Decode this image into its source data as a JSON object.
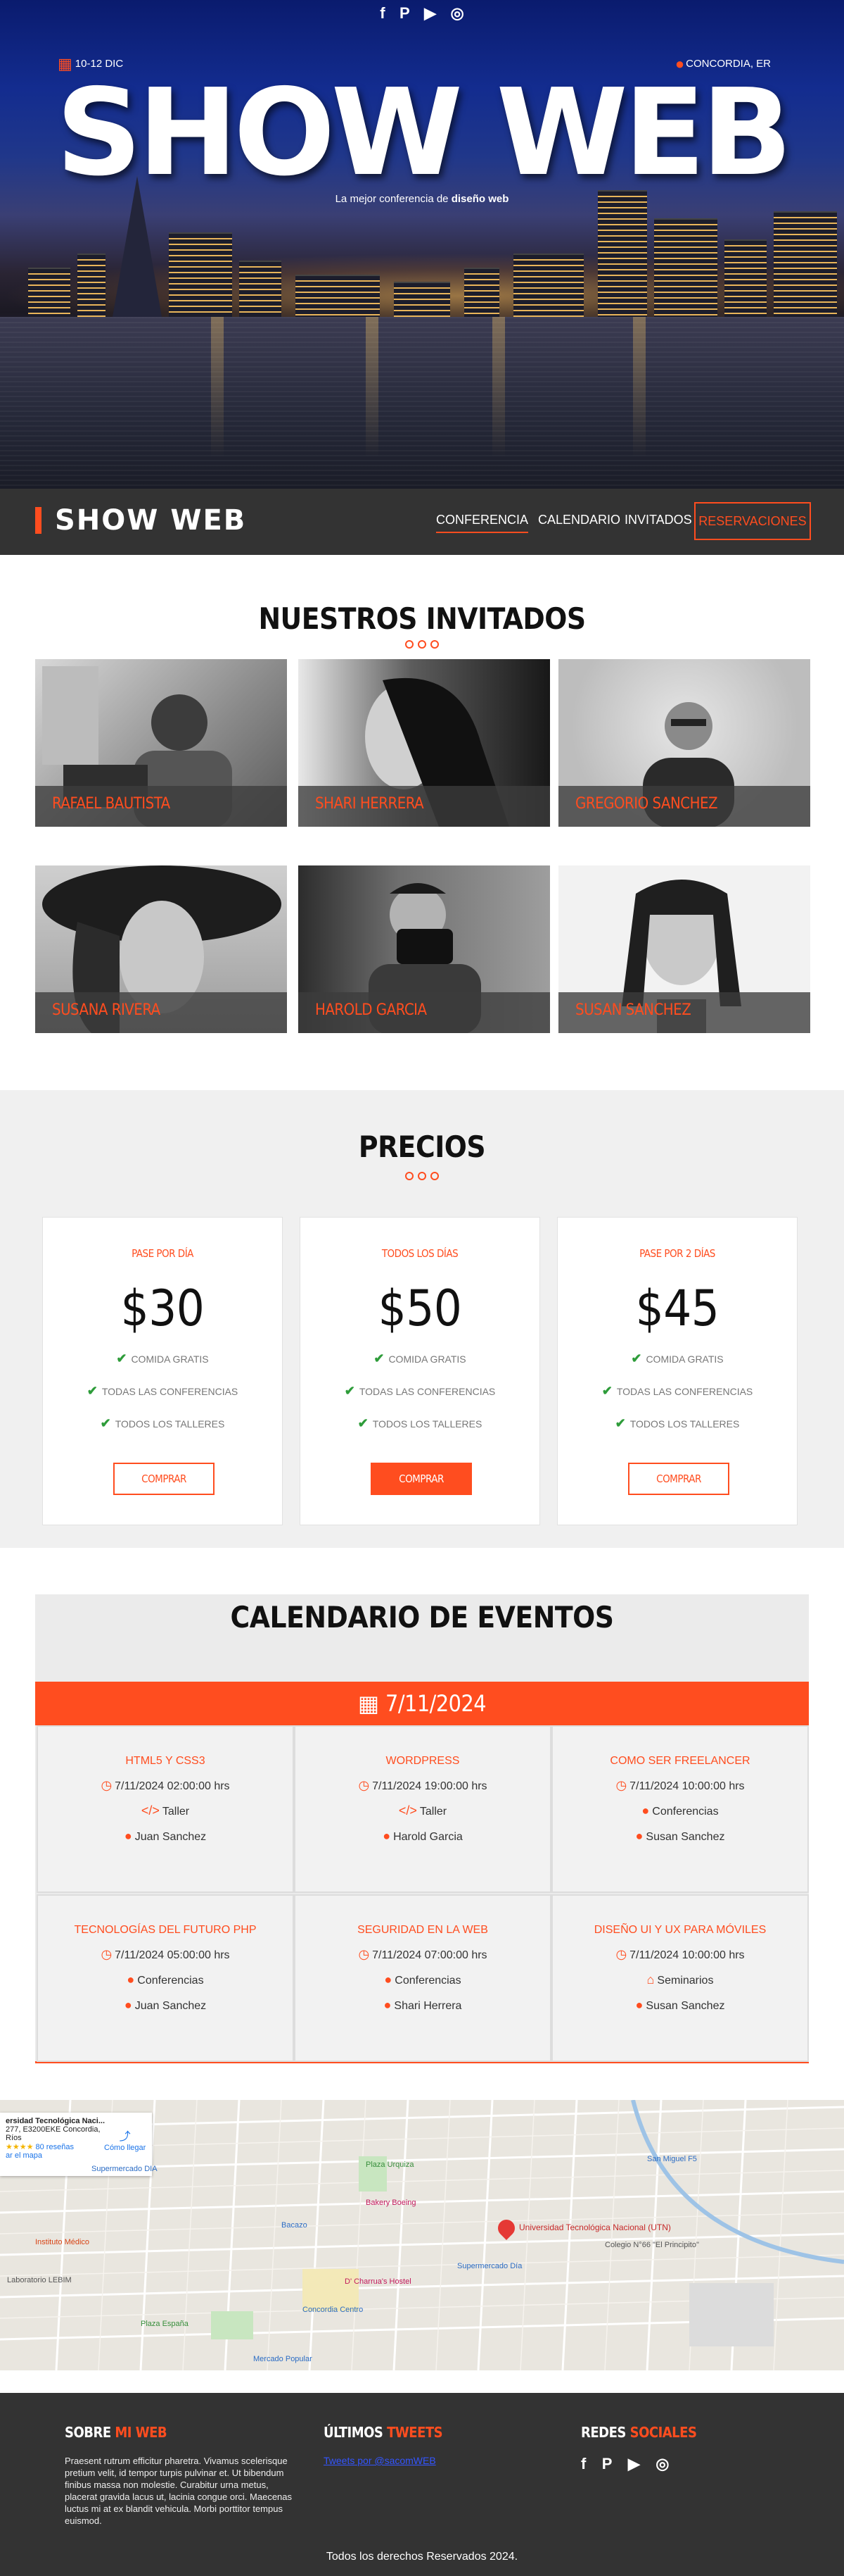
{
  "hero": {
    "social_icons": [
      "facebook-icon",
      "pinterest-icon",
      "youtube-icon",
      "instagram-icon"
    ],
    "social_glyphs": [
      "f",
      "P",
      "▶",
      "◎"
    ],
    "date": "10-12 DIC",
    "location": "CONCORDIA, ER",
    "title": "SHOW WEB",
    "subtitle_prefix": "La mejor conferencia de ",
    "subtitle_bold": "diseño web"
  },
  "nav": {
    "logo": "SHOW WEB",
    "items": [
      "CONFERENCIA",
      "CALENDARIO",
      "INVITADOS"
    ],
    "reserve": "RESERVACIONES"
  },
  "guests": {
    "title": "NUESTROS INVITADOS",
    "items": [
      "RAFAEL BAUTISTA",
      "SHARI HERRERA",
      "GREGORIO SANCHEZ",
      "SUSANA RIVERA",
      "HAROLD GARCIA",
      "SUSAN  SANCHEZ"
    ]
  },
  "prices": {
    "title": "PRECIOS",
    "plans": [
      {
        "label": "PASE POR DÍA",
        "price": "$30",
        "features": [
          "COMIDA GRATIS",
          "TODAS LAS CONFERENCIAS",
          "TODOS LOS TALLERES"
        ],
        "button": "COMPRAR"
      },
      {
        "label": "TODOS LOS DÍAS",
        "price": "$50",
        "features": [
          "COMIDA GRATIS",
          "TODAS LAS CONFERENCIAS",
          "TODOS LOS TALLERES"
        ],
        "button": "COMPRAR"
      },
      {
        "label": "PASE POR 2 DÍAS",
        "price": "$45",
        "features": [
          "COMIDA GRATIS",
          "TODAS LAS CONFERENCIAS",
          "TODOS LOS TALLERES"
        ],
        "button": "COMPRAR"
      }
    ]
  },
  "calendar": {
    "title": "CALENDARIO DE EVENTOS",
    "date": "7/11/2024",
    "events": [
      {
        "title": "HTML5 Y CSS3",
        "time": "7/11/2024 02:00:00 hrs",
        "category": "Taller",
        "cat_icon": "code-icon",
        "speaker": "Juan Sanchez"
      },
      {
        "title": "WORDPRESS",
        "time": "7/11/2024 19:00:00 hrs",
        "category": "Taller",
        "cat_icon": "code-icon",
        "speaker": "Harold Garcia"
      },
      {
        "title": "COMO SER FREELANCER",
        "time": "7/11/2024 10:00:00 hrs",
        "category": "Conferencias",
        "cat_icon": "comment-icon",
        "speaker": "Susan Sanchez"
      },
      {
        "title": "TECNOLOGÍAS DEL FUTURO PHP",
        "time": "7/11/2024 05:00:00 hrs",
        "category": "Conferencias",
        "cat_icon": "comment-icon",
        "speaker": "Juan Sanchez"
      },
      {
        "title": "SEGURIDAD EN LA WEB",
        "time": "7/11/2024 07:00:00 hrs",
        "category": "Conferencias",
        "cat_icon": "comment-icon",
        "speaker": "Shari Herrera"
      },
      {
        "title": "DISEÑO UI Y UX PARA MÓVILES",
        "time": "7/11/2024 10:00:00 hrs",
        "category": "Seminarios",
        "cat_icon": "university-icon",
        "speaker": "Susan Sanchez"
      }
    ]
  },
  "map": {
    "place_name": "ersidad Tecnológica Naci...",
    "address": "277, E3200EKE Concordia,",
    "region": "Ríos",
    "rating": "★★★★",
    "reviews": "80 reseñas",
    "larger_map": "ar el mapa",
    "directions": "Cómo llegar",
    "pin_label": "Universidad Tecnológica Nacional (UTN)",
    "labels": [
      "Supermercado DIA",
      "Instituto Médico",
      "Supermercado Día",
      "Plaza Urquiza",
      "Bakery Boeing",
      "San Miguel F5",
      "Colegio N°66 \"El Principito\"",
      "Plaza España",
      "Bacazo",
      "D' Charrua's Hostel",
      "Concordia Centro",
      "Mercado Popular",
      "Laboratorio LEBIM"
    ]
  },
  "footer": {
    "about_title_1": "SOBRE ",
    "about_title_2": "MI WEB",
    "about_text": "Praesent rutrum efficitur pharetra. Vivamus scelerisque pretium velit, id tempor turpis pulvinar et. Ut bibendum finibus massa non molestie. Curabitur urna metus, placerat gravida lacus ut, lacinia congue orci. Maecenas luctus mi at ex blandit vehicula. Morbi porttitor tempus euismod.",
    "tweets_title_1": "ÚLTIMOS ",
    "tweets_title_2": "TWEETS",
    "tweets_link": "Tweets por @sacomWEB",
    "social_title_1": "REDES ",
    "social_title_2": "SOCIALES",
    "copyright": "Todos los derechos Reservados 2024."
  }
}
